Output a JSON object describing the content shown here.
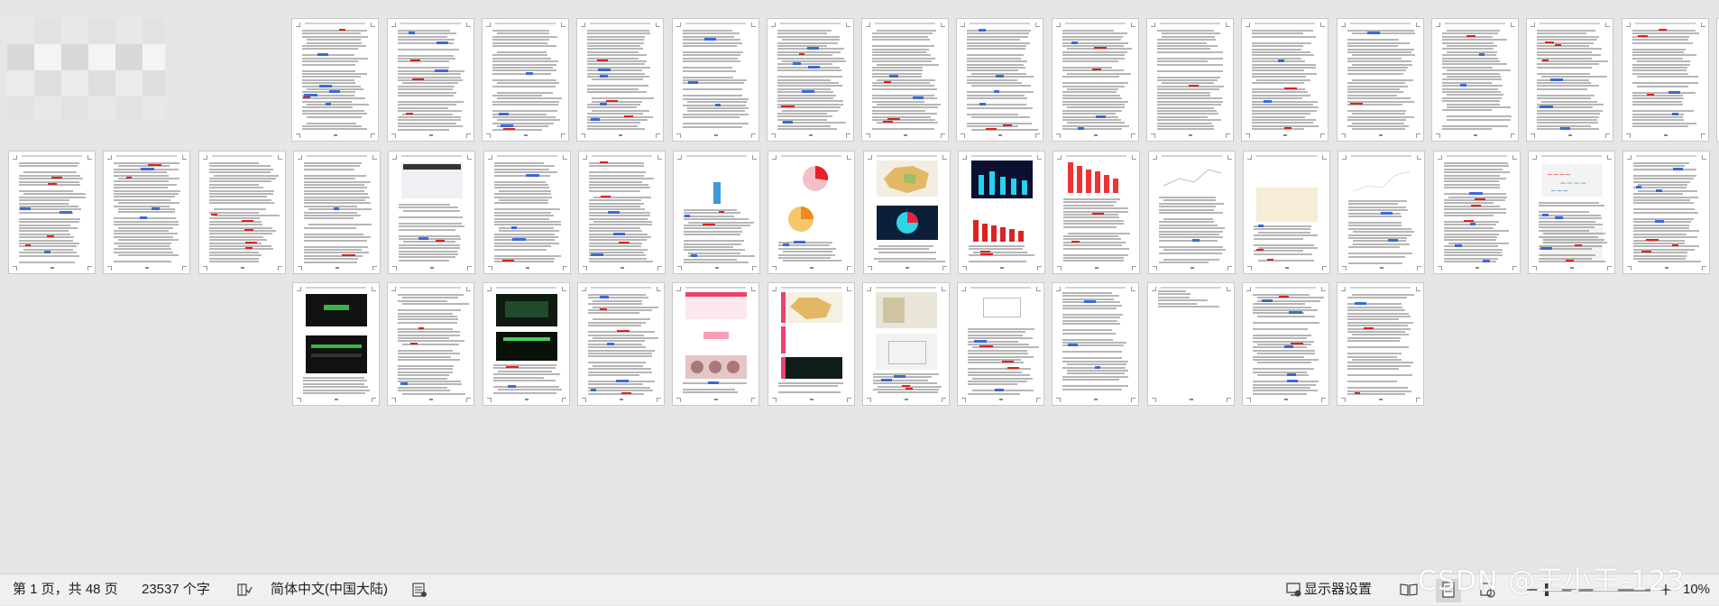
{
  "status": {
    "page_info": "第 1 页，共 48 页",
    "word_count": "23537 个字",
    "language": "简体中文(中国大陆)",
    "display_settings": "显示器设置",
    "zoom": "10%"
  },
  "thumbnails": {
    "total_pages": 48,
    "rows": [
      18,
      18,
      12
    ]
  },
  "watermark": "CSDN @王小王-123",
  "icons": {
    "proofing": "book-check-icon",
    "accessibility": "accessibility-icon",
    "display": "display-settings-icon",
    "read_mode": "read-mode-icon",
    "print_layout": "print-layout-icon",
    "web_layout": "web-layout-icon",
    "zoom_out": "zoom-out-icon",
    "zoom_in": "zoom-in-icon"
  },
  "colors": {
    "workspace": "#e6e6e6",
    "statusbar": "#f0f0f0",
    "spell_error": "#e0201a",
    "grammar_mark": "#2b5fd9"
  }
}
